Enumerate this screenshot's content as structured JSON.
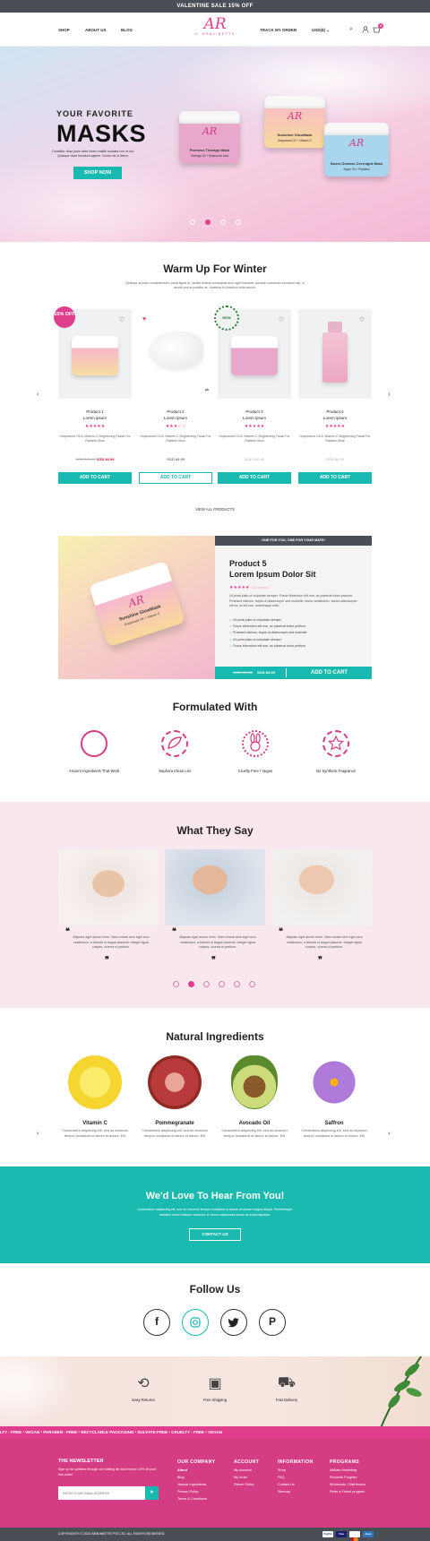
{
  "top_banner": "VALENTINE SALE 15% OFF",
  "nav": {
    "left": [
      "SHOP",
      "ABOUT US",
      "BLOG"
    ],
    "logo_mark": "AR",
    "logo_text": "D. ARAVINETTE",
    "track": "TRACK MY ORDER",
    "currency": "USD($)",
    "cart_count": "0"
  },
  "hero": {
    "eyebrow": "YOUR FAVORITE",
    "headline": "MASKS",
    "body": "Curabitur vitae justo vitae lorem mattis sodales non et dui. Quisque vitae tincidunt sapien. Donec sit ut libero.",
    "cta": "SHOP NOW",
    "jars": [
      {
        "name": "Poreless Therapy Mask",
        "sub": "Moringa Oil + Hyaluronic Acid",
        "color": "#e7a8cc"
      },
      {
        "name": "Sunshine GlowMask",
        "sub": "Grapeseed Oil + Vitamin C",
        "color": "#f6cfae"
      },
      {
        "name": "Sweet Dreams Overnight Mask",
        "sub": "Argan Oil + Peptides",
        "color": "#a9d6ee"
      }
    ]
  },
  "winter": {
    "title": "Warm Up For Winter",
    "subtitle": "Quisque at justo condimentum, porta ligula et, facilisi finibus consequat arcu eget tincidunt. Aenean commodo tincidunt nisl, in auctor purus porttitor at. Vivamus in tincidunt nulla auctor.",
    "view_all": "VIEW ALL PRODUCTS",
    "badge": "15% OFF",
    "new_badge": "NEW",
    "products": [
      {
        "name": "Product 1",
        "line2": "Lorem ipsum",
        "stars": "★★★★★",
        "desc": "Grapeseed Oil & Vitamin C Brightening Facial For Radiant Glow",
        "old": "SGD 100.00",
        "price": "SGD 84.99",
        "cart": "ADD TO CART"
      },
      {
        "name": "Product 2",
        "line2": "Lorem ipsum",
        "stars": "★★★☆☆",
        "desc": "Grapeseed Oil & Vitamin C Brightening Facial For Radiant Glow",
        "old": "",
        "price": "SGD 84.99",
        "cart": "ADD TO CART"
      },
      {
        "name": "Product 3",
        "line2": "Lorem ipsum",
        "stars": "★★★★★",
        "desc": "Grapeseed Oil & Vitamin C Brightening Facial For Radiant Glow",
        "old": "",
        "price": "SGD 100.00",
        "cart": "ADD TO CART"
      },
      {
        "name": "Product 4",
        "line2": "Lorem ipsum",
        "stars": "★★★★★",
        "desc": "Grapeseed Oil & Vitamin C Brightening Facial For Radiant Glow",
        "old": "",
        "price": "SGD 84.99",
        "cart": "ADD TO CART"
      }
    ]
  },
  "spotlight": {
    "bar": "ONE FOR YOU, ONE FOR YOUR MATE!",
    "title1": "Product 5",
    "title2": "Lorem Ipsum Dolor Sit",
    "stars": "★★★★★",
    "reviews": "234 reviews",
    "body": "Ut porta justo ut vulputate semper. Fusce bibendum elit non, ac placerat tortor pretium. Praesent ultrices, turpis ut ullamcorper sed molestie, libero vestibulum, varius ullamcorper elit ex, at elit non, scelerisque nibh.",
    "bullets": [
      "Ut porta justo ut vulputate semper",
      "Fusce bibendum elit non, ac placerat tortor pretium",
      "Praesent ultrices, turpis ut ullamcorper sed molestie",
      "Ut porta justo ut vulputate semper",
      "Fusce bibendum elit non, ac placerat tortor pretium"
    ],
    "old": "SGD 100.00",
    "price": "SGD 84.99",
    "cart": "ADD TO CART",
    "jar_name": "Sunshine GlowMask",
    "jar_sub": "Grapeseed Oil + Vitamin C"
  },
  "formulated": {
    "title": "Formulated With",
    "items": [
      {
        "label": "Ancient Ingredients That Work"
      },
      {
        "label": "Sephora Clean List"
      },
      {
        "label": "Cruelty Free / Vegan"
      },
      {
        "label": "No Synthetic Fragrance"
      }
    ]
  },
  "testimonials": {
    "title": "What They Say",
    "quote": "Aliquam eget auctor enim. Nam ornare sem eget arcu vestibulum, a blandit ut augue placerat. Integer ligula cuspes, viverra ut pretium."
  },
  "ingredients": {
    "title": "Natural Ingredients",
    "items": [
      {
        "name": "Vitamin C",
        "desc": "Consectetur adipiscing elit, sed do eiusmod tempor incididunt ut labore et dolore. Elit"
      },
      {
        "name": "Pommegranate",
        "desc": "Consectetur adipiscing elit, sed do eiusmod tempor incididunt ut labore et dolore. Elit"
      },
      {
        "name": "Avocado Oil",
        "desc": "Consectetur adipiscing elit, sed do eiusmod tempor incididunt ut labore et dolore. Elit"
      },
      {
        "name": "Saffron",
        "desc": "Consectetur adipiscing elit, sed do eiusmod tempor incididunt ut labore et dolore. Elit"
      }
    ]
  },
  "contact": {
    "title": "We'd Love To Hear From You!",
    "body": "Consectetur adipiscing elit, sed do eiusmod tempor incididunt ut labore et dolore magna aliqua. Pellentesque habitant morbi tristique senectus et netus malesuada fames ac turpis egestas.",
    "cta": "CONTACT US"
  },
  "follow": {
    "title": "Follow Us"
  },
  "perks": [
    "Easy Returns",
    "Free Shipping",
    "Fast Delivery"
  ],
  "ticker": "LTY - FREE  •  VEGAN  •  PARABEN - FREE  •  RECYCLABLE PACKAGING  •  SULFATE-FREE  •  CRUELTY - FREE  •  VEGAN",
  "footer": {
    "newsletter_title": "THE NEWSLETTER",
    "newsletter_text": "Sign up for updates through our mailing list and receive 10% off your first order!",
    "email_placeholder": "ENTER YOUR EMAIL ADDRESS",
    "company": {
      "title": "OUR COMPANY",
      "links": [
        "About",
        "Blog",
        "Natural Ingredients",
        "Privacy Policy",
        "Terms & Conditions"
      ]
    },
    "account": {
      "title": "ACCOUNT",
      "links": [
        "My Account",
        "My order",
        "Return Policy"
      ]
    },
    "information": {
      "title": "INFORMATION",
      "links": [
        "Shop",
        "FAQ",
        "Contact Us",
        "Sitemap"
      ]
    },
    "programs": {
      "title": "PROGRAMS",
      "links": [
        "Affiliate Marketing",
        "Rewards Program",
        "Wholesale / Distribution",
        "Refer a Friend program"
      ]
    },
    "copyright": "COPYRIGHTS © 2023 ARAVINETTE PTE LTD. ALL RIGHTS RESERVED.",
    "payments": [
      "PayPal",
      "Visa",
      "Mastercard",
      "Amex"
    ]
  },
  "colors": {
    "accent": "#e03e8c",
    "teal": "#18b9b0",
    "dark": "#4a4f55"
  }
}
